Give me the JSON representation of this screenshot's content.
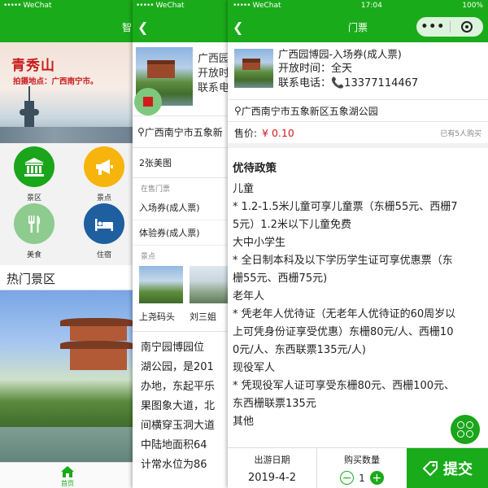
{
  "screen1": {
    "status": {
      "carrier": "WeChat",
      "signal": "•••••"
    },
    "nav_title": "智",
    "banner": {
      "title": "青秀山",
      "subtitle": "拍摄地点：广西南宁市。"
    },
    "grid": [
      {
        "label": "景区",
        "icon": "building-icon",
        "color": "#1aa51a"
      },
      {
        "label": "景点",
        "icon": "megaphone-icon",
        "color": "#f7b40c"
      },
      {
        "label": "美食",
        "icon": "cutlery-icon",
        "color": "#8ecb8e"
      },
      {
        "label": "住宿",
        "icon": "bed-icon",
        "color": "#1e5f9f"
      }
    ],
    "hot_title": "热门景区",
    "tab_home": "首页"
  },
  "screen2": {
    "status": {
      "carrier": "WeChat",
      "signal": "•••••"
    },
    "info": {
      "line1": "广西园",
      "line2": "开放时",
      "line3": "联系电"
    },
    "address": "广西南宁市五象新",
    "image_count": "2张美图",
    "section_tickets": "在售门票",
    "tickets": [
      "入场券(成人票)",
      "体验券(成人票)"
    ],
    "section_spots": "景点",
    "spots": [
      "上尧码头",
      "刘三姐"
    ],
    "desc_lines": [
      "南宁园博园位",
      "湖公园，是201",
      "办地，东起平乐",
      "果图象大道，北",
      "间横穿玉洞大道",
      "中陆地面积64",
      "计常水位为86"
    ]
  },
  "screen3": {
    "status": {
      "carrier": "WeChat",
      "signal": "•••••",
      "time": "17:04",
      "battery": "100%"
    },
    "nav_title": "门票",
    "ticket_name": "广西园博园-入场券(成人票)",
    "open_time": "开放时间：全天",
    "phone": "联系电话：📞13377114467",
    "address": "广西南宁市五象新区五象湖公园",
    "price_label": "售价:",
    "price_value": "¥ 0.10",
    "sold": "已有5人购买",
    "policy_title": "优待政策",
    "policy_lines": [
      "儿童",
      "* 1.2-1.5米儿童可享儿童票（东栅55元、西栅7",
      "5元）1.2米以下儿童免费",
      "大中小学生",
      "* 全日制本科及以下学历学生证可享优惠票（东",
      "栅55元、西栅75元)",
      "老年人",
      "* 凭老年人优待证（无老年人优待证的60周岁以",
      "上可凭身份证享受优惠）东栅80元/人、西栅10",
      "0元/人、东西联票135元/人)",
      "现役军人",
      "* 凭现役军人证可享受东栅80元、西栅100元、",
      "东西栅联票135元",
      "其他"
    ],
    "bottom": {
      "date_label": "出游日期",
      "date_value": "2019-4-2",
      "qty_label": "购买数量",
      "qty_value": "1",
      "minus": "−",
      "plus": "+",
      "submit": "提交"
    }
  }
}
